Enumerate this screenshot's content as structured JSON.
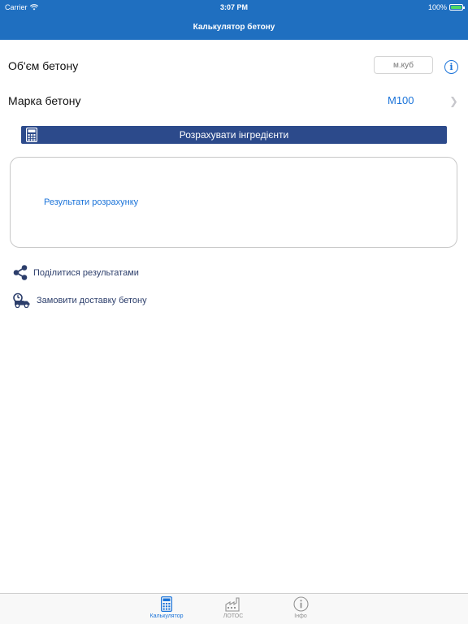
{
  "status_bar": {
    "carrier": "Carrier",
    "time": "3:07 PM",
    "battery": "100%",
    "battery_level": 1.0,
    "icons": [
      "wifi-icon",
      "battery-icon"
    ]
  },
  "nav": {
    "title": "Калькулятор бетону"
  },
  "form": {
    "volume_label": "Об'єм бетону",
    "volume_placeholder": "м.куб",
    "volume_value": "",
    "grade_label": "Марка бетону",
    "grade_value": "М100"
  },
  "calculate_button": {
    "label": "Розрахувати інгредієнти",
    "icon": "calculator-icon"
  },
  "results": {
    "placeholder": "Результати розрахунку"
  },
  "actions": {
    "share_label": "Поділитися результатами",
    "share_icon": "share-icon",
    "delivery_label": "Замовити доставку бетону",
    "delivery_icon": "delivery-truck-icon"
  },
  "tabs": [
    {
      "label": "Калькулятор",
      "icon": "calculator-icon",
      "active": true
    },
    {
      "label": "ЛОТОС",
      "icon": "factory-icon",
      "active": false
    },
    {
      "label": "Інфо",
      "icon": "info-icon",
      "active": false
    }
  ],
  "colors": {
    "nav_bar": "#1f6fc0",
    "accent": "#1a73d9",
    "button": "#2c4a8b",
    "action_text": "#2c3e6b"
  }
}
